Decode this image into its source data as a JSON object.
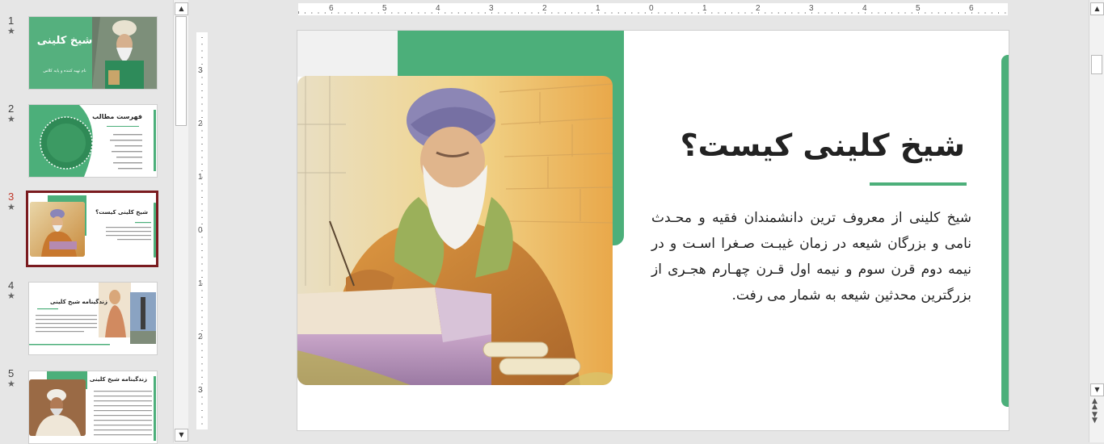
{
  "colors": {
    "accent_green": "#4caf7a",
    "active_border": "#7a1b1f"
  },
  "thumbnails": [
    {
      "number": "1",
      "star": "★",
      "title": "شیخ کلینی",
      "subtitle": "نام تهیه کننده و پایه کلاس"
    },
    {
      "number": "2",
      "star": "★",
      "title": "فهرست مطالب"
    },
    {
      "number": "3",
      "star": "★",
      "title": "شیخ کلینی کیست؟"
    },
    {
      "number": "4",
      "star": "★",
      "title": "زندگینامه شیخ کلینی"
    },
    {
      "number": "5",
      "star": "★",
      "title": "زندگینامه شیخ کلینی"
    }
  ],
  "ruler": {
    "horizontal": [
      "6",
      "5",
      "4",
      "3",
      "2",
      "1",
      "0",
      "1",
      "2",
      "3",
      "4",
      "5",
      "6"
    ],
    "vertical": [
      "3",
      "2",
      "1",
      "0",
      "1",
      "2",
      "3"
    ]
  },
  "slide": {
    "title": "شیخ کلینی کیست؟",
    "body": "شیخ کلینی از معروف ترین دانشمندان فقیه و محـدث نامی و بزرگان شیعه در زمان غیبـت صـغرا اسـت و در نیمه دوم قرن سوم و نیمه اول قـرن چهـارم هجـری از بزرگترین محدثین شیعه به شمار می رفت.",
    "illustration": "scholar-writing-illustration"
  }
}
